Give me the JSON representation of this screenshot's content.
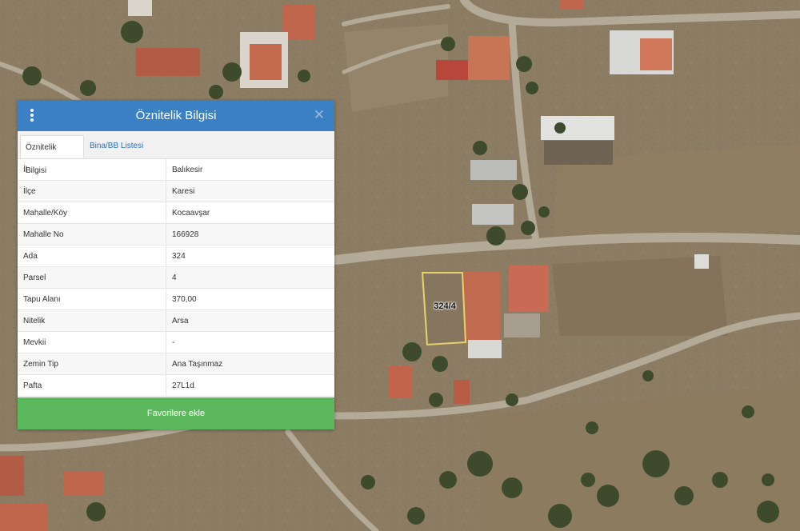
{
  "panel": {
    "title": "Öznitelik Bilgisi",
    "tabs": [
      {
        "label": "Öznitelik Bilgisi",
        "active": true
      },
      {
        "label": "Bina/BB Listesi",
        "active": false
      }
    ],
    "rows": [
      {
        "key": "İl",
        "value": "Balıkesir"
      },
      {
        "key": "İlçe",
        "value": "Karesi"
      },
      {
        "key": "Mahalle/Köy",
        "value": "Kocaavşar"
      },
      {
        "key": "Mahalle No",
        "value": "166928"
      },
      {
        "key": "Ada",
        "value": "324"
      },
      {
        "key": "Parsel",
        "value": "4"
      },
      {
        "key": "Tapu Alanı",
        "value": "370,00"
      },
      {
        "key": "Nitelik",
        "value": "Arsa"
      },
      {
        "key": "Mevkii",
        "value": "-"
      },
      {
        "key": "Zemin Tip",
        "value": "Ana Taşınmaz"
      },
      {
        "key": "Pafta",
        "value": "27L1d"
      }
    ],
    "favorite_button": "Favorilere ekle",
    "header_color": "#3c80c4",
    "button_color": "#5cb85c",
    "icons": {
      "menu": "vertical-dots-icon",
      "close": "close-icon"
    }
  },
  "map": {
    "parcel_label": "324/4",
    "parcel_outline_color": "#e6d36a"
  }
}
